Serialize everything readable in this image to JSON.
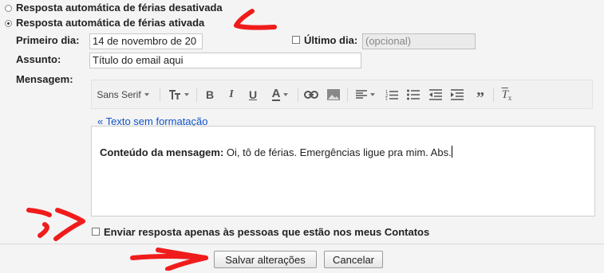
{
  "vacation": {
    "off_label": "Resposta automática de férias desativada",
    "on_label": "Resposta automática de férias ativada",
    "first_day_label": "Primeiro dia:",
    "first_day_value": "14 de novembro de 20",
    "last_day_label": "Último dia:",
    "last_day_placeholder": "(opcional)",
    "subject_label": "Assunto:",
    "subject_value": "Título do email aqui",
    "message_label": "Mensagem:"
  },
  "toolbar": {
    "font_family": "Sans Serif",
    "icons": [
      "text-size-icon",
      "bold-icon",
      "italic-icon",
      "underline-icon",
      "text-color-icon",
      "link-icon",
      "image-icon",
      "align-icon",
      "numbered-list-icon",
      "bulleted-list-icon",
      "indent-less-icon",
      "indent-more-icon",
      "quote-icon",
      "remove-formatting-icon"
    ]
  },
  "plain_text_link": "« Texto sem formatação",
  "message": {
    "lead": "Conteúdo da mensagem:",
    "body": " Oi, tô de férias. Emergências ligue pra mim. Abs."
  },
  "contacts_only_label": "Enviar resposta apenas às pessoas que estão nos meus Contatos",
  "buttons": {
    "save": "Salvar alterações",
    "cancel": "Cancelar"
  },
  "annotation_color": "#f01c1c"
}
